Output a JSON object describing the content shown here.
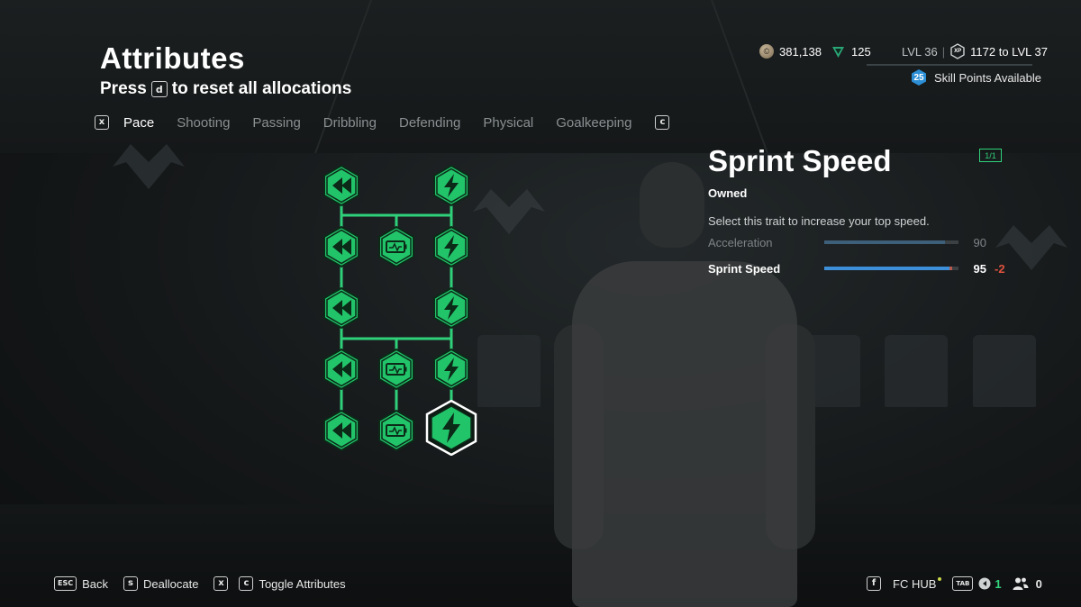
{
  "header": {
    "title": "Attributes",
    "reset_prefix": "Press",
    "reset_key": "d",
    "reset_suffix": "to reset all allocations"
  },
  "tabs": {
    "prev_key": "x",
    "next_key": "c",
    "items": [
      {
        "label": "Pace",
        "active": true
      },
      {
        "label": "Shooting",
        "active": false
      },
      {
        "label": "Passing",
        "active": false
      },
      {
        "label": "Dribbling",
        "active": false
      },
      {
        "label": "Defending",
        "active": false
      },
      {
        "label": "Physical",
        "active": false
      },
      {
        "label": "Goalkeeping",
        "active": false
      }
    ]
  },
  "top_right": {
    "coins": "381,138",
    "points": "125",
    "level": "LVL 36",
    "xp_text": "1172 to LVL 37",
    "xp_icon_text": "XP",
    "xp_progress": 0.0,
    "skill_points_count": "25",
    "skill_points_label": "Skill Points Available"
  },
  "skill_tree": {
    "nodes": [
      {
        "name": "pace-node-1",
        "icon": "acceleration-icon"
      },
      {
        "name": "pace-node-2",
        "icon": "sprint-speed-icon"
      },
      {
        "name": "pace-node-3",
        "icon": "acceleration-icon"
      },
      {
        "name": "pace-node-4",
        "icon": "battery-icon"
      },
      {
        "name": "pace-node-5",
        "icon": "sprint-speed-icon"
      },
      {
        "name": "pace-node-6",
        "icon": "acceleration-icon"
      },
      {
        "name": "pace-node-7",
        "icon": "sprint-speed-icon"
      },
      {
        "name": "pace-node-8",
        "icon": "acceleration-icon"
      },
      {
        "name": "pace-node-9",
        "icon": "battery-icon"
      },
      {
        "name": "pace-node-10",
        "icon": "sprint-speed-icon"
      },
      {
        "name": "pace-node-11",
        "icon": "acceleration-icon"
      },
      {
        "name": "pace-node-12",
        "icon": "battery-icon"
      },
      {
        "name": "pace-node-13",
        "icon": "sprint-speed-icon",
        "selected": true
      }
    ]
  },
  "detail": {
    "trait_name": "Sprint Speed",
    "count": "1/1",
    "status": "Owned",
    "description": "Select this trait to increase your top speed.",
    "stats": [
      {
        "label": "Acceleration",
        "value": "90",
        "level": 0.9,
        "delta": ""
      },
      {
        "label": "Sprint Speed",
        "value": "95",
        "level": 0.95,
        "delta": "-2"
      }
    ]
  },
  "footer": {
    "back_key": "ESC",
    "back_label": "Back",
    "deallocate_key": "s",
    "deallocate_label": "Deallocate",
    "toggle_key_1": "x",
    "toggle_key_2": "c",
    "toggle_label": "Toggle Attributes",
    "hub_key": "f",
    "hub_label": "FC HUB",
    "tab_key": "TAB",
    "online_count": "1",
    "friends_count": "0"
  },
  "colors": {
    "accent_green": "#2fd07a",
    "node_fill": "#22c46a",
    "xp_blue": "#4aa6e6",
    "stat_blue": "#3d8fd9",
    "delta_red": "#e0523e"
  }
}
